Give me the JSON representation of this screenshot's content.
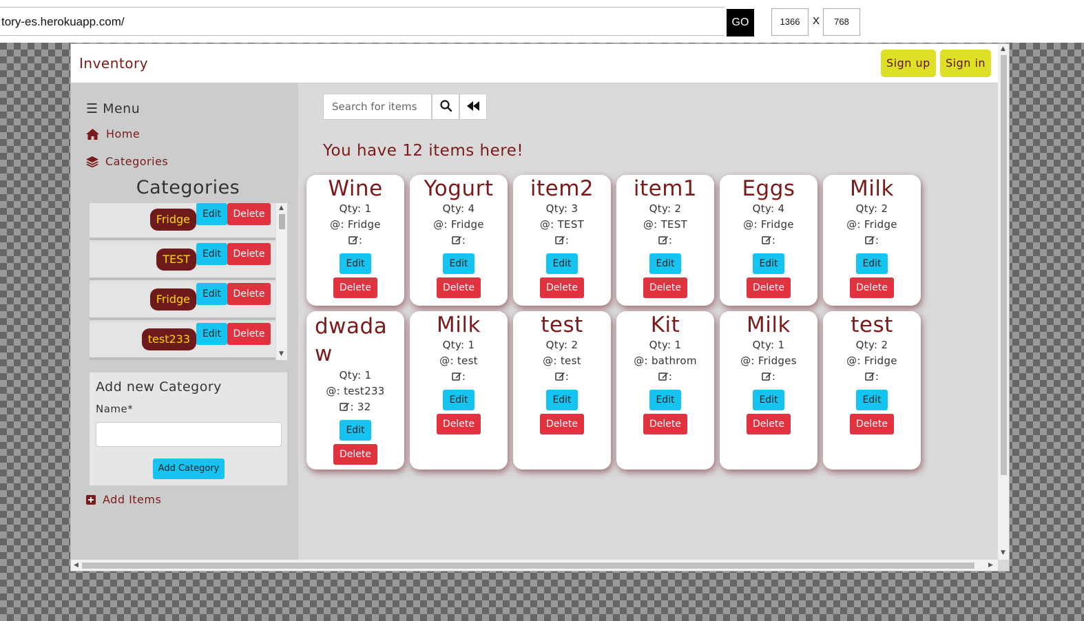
{
  "browser": {
    "url": "tory-es.herokuapp.com/",
    "go_label": "GO",
    "width": "1366",
    "x_label": "X",
    "height": "768"
  },
  "navbar": {
    "brand": "Inventory",
    "signup_label": "Sign up",
    "signin_label": "Sign in"
  },
  "sidebar": {
    "menu_label": "Menu",
    "home_label": "Home",
    "categories_label": "Categories",
    "categories_title": "Categories",
    "category_rows": [
      {
        "name": "Fridge",
        "edit": "Edit",
        "delete": "Delete"
      },
      {
        "name": "TEST",
        "edit": "Edit",
        "delete": "Delete"
      },
      {
        "name": "Fridge",
        "edit": "Edit",
        "delete": "Delete"
      },
      {
        "name": "test233",
        "edit": "Edit",
        "delete": "Delete"
      }
    ],
    "add_category": {
      "title": "Add new Category",
      "name_label": "Name*",
      "name_value": "",
      "button_label": "Add Category"
    },
    "add_items_label": "Add Items"
  },
  "content": {
    "search_placeholder": "Search for items",
    "heading": "You have 12 items here!",
    "items": [
      {
        "name": "Wine",
        "qty": "Qty: 1",
        "location": ": Fridge",
        "note": ":",
        "edit": "Edit",
        "delete": "Delete"
      },
      {
        "name": "Yogurt",
        "qty": "Qty: 4",
        "location": ": Fridge",
        "note": ":",
        "edit": "Edit",
        "delete": "Delete"
      },
      {
        "name": "item2",
        "qty": "Qty: 3",
        "location": ": TEST",
        "note": ":",
        "edit": "Edit",
        "delete": "Delete"
      },
      {
        "name": "item1",
        "qty": "Qty: 2",
        "location": ": TEST",
        "note": ":",
        "edit": "Edit",
        "delete": "Delete"
      },
      {
        "name": "Eggs",
        "qty": "Qty: 4",
        "location": ": Fridge",
        "note": ":",
        "edit": "Edit",
        "delete": "Delete"
      },
      {
        "name": "Milk",
        "qty": "Qty: 2",
        "location": ": Fridge",
        "note": ":",
        "edit": "Edit",
        "delete": "Delete"
      },
      {
        "name": "dwadaw",
        "qty": "Qty: 1",
        "location": ": test233",
        "note": ": 32",
        "edit": "Edit",
        "delete": "Delete"
      },
      {
        "name": "Milk",
        "qty": "Qty: 1",
        "location": ": test",
        "note": ":",
        "edit": "Edit",
        "delete": "Delete"
      },
      {
        "name": "test",
        "qty": "Qty: 2",
        "location": ": test",
        "note": ":",
        "edit": "Edit",
        "delete": "Delete"
      },
      {
        "name": "Kit",
        "qty": "Qty: 1",
        "location": ": bathrom",
        "note": ":",
        "edit": "Edit",
        "delete": "Delete"
      },
      {
        "name": "Milk",
        "qty": "Qty: 1",
        "location": ": Fridges",
        "note": ":",
        "edit": "Edit",
        "delete": "Delete"
      },
      {
        "name": "test",
        "qty": "Qty: 2",
        "location": ": Fridge",
        "note": ":",
        "edit": "Edit",
        "delete": "Delete"
      }
    ]
  },
  "colors": {
    "brand_maroon": "#7a1a1a",
    "nav_button_yellow": "#dde024",
    "edit_cyan": "#15c4f0",
    "delete_red": "#e0323f",
    "pill_maroon": "#6e1a1a",
    "pill_text_gold": "#ffd700"
  }
}
